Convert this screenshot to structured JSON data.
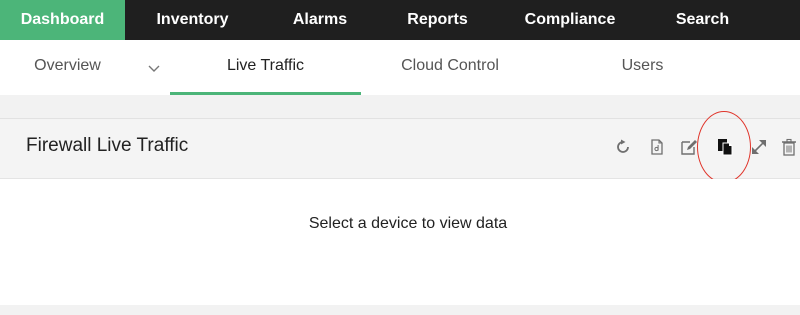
{
  "top_nav": {
    "items": [
      {
        "label": "Dashboard",
        "active": true
      },
      {
        "label": "Inventory",
        "active": false
      },
      {
        "label": "Alarms",
        "active": false
      },
      {
        "label": "Reports",
        "active": false
      },
      {
        "label": "Compliance",
        "active": false
      },
      {
        "label": "Search",
        "active": false
      }
    ]
  },
  "sub_nav": {
    "tabs": [
      {
        "label": "Overview",
        "active": false,
        "has_dropdown": true
      },
      {
        "label": "Live Traffic",
        "active": true
      },
      {
        "label": "Cloud Control",
        "active": false
      },
      {
        "label": "Users",
        "active": false
      }
    ]
  },
  "widget": {
    "title": "Firewall Live Traffic",
    "tools": [
      {
        "icon": "refresh-icon"
      },
      {
        "icon": "export-pdf-icon"
      },
      {
        "icon": "edit-icon"
      },
      {
        "icon": "copy-icon",
        "highlighted": true
      },
      {
        "icon": "expand-icon"
      },
      {
        "icon": "trash-icon"
      }
    ],
    "empty_message": "Select a device to view data"
  },
  "colors": {
    "accent": "#4cb579",
    "topnav_bg": "#1f1f1f",
    "highlight": "#e0352b",
    "icon_gray": "#777777"
  }
}
